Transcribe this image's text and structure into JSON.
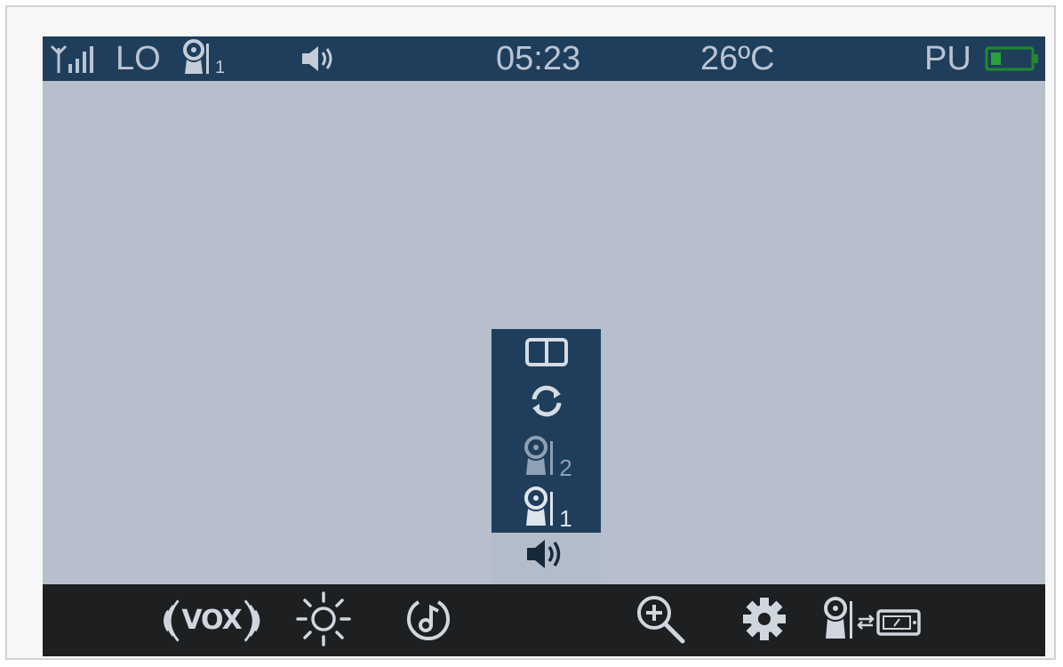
{
  "status_bar": {
    "range_label": "LO",
    "camera_number": "1",
    "time": "05:23",
    "temperature": "26ºC",
    "power_label": "PU"
  },
  "scan_menu": {
    "camera_2_number": "2",
    "camera_1_number": "1"
  },
  "toolbar": {
    "vox_label": "VOX"
  },
  "colors": {
    "screen_bg": "#b6bfcb",
    "status_bar_bg": "#1f3e5b",
    "toolbar_bg": "#1d1f21",
    "icon_light": "#cfd6de"
  }
}
